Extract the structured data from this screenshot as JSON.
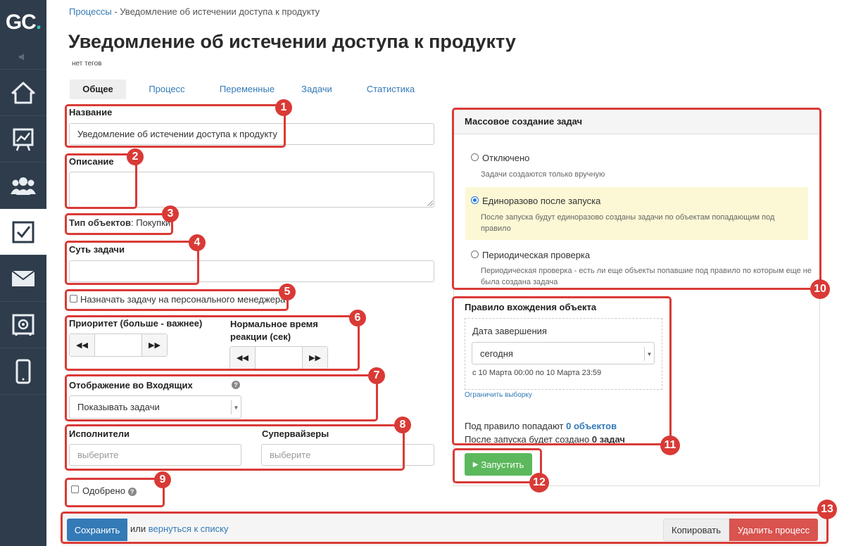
{
  "sidebar": {
    "logo": "GC",
    "logo_dot": ".",
    "items": [
      {
        "name": "home"
      },
      {
        "name": "stats"
      },
      {
        "name": "users"
      },
      {
        "name": "tasks",
        "active": true
      },
      {
        "name": "mail"
      },
      {
        "name": "safe"
      },
      {
        "name": "mobile"
      }
    ]
  },
  "breadcrumb": {
    "link": "Процессы",
    "separator": "-",
    "current": "Уведомление об истечении доступа к продукту"
  },
  "page": {
    "title": "Уведомление об истечении доступа к продукту",
    "tags": "нет тегов"
  },
  "tabs": [
    "Общее",
    "Процесс",
    "Переменные",
    "Задачи",
    "Статистика"
  ],
  "form": {
    "name_label": "Название",
    "name_value": "Уведомление об истечении доступа к продукту",
    "description_label": "Описание",
    "object_type_label": "Тип объектов",
    "object_type_value": ": Покупки",
    "task_essence_label": "Суть задачи",
    "assign_manager_label": "Назначать задачу на персонального менеджера",
    "priority_label": "Приоритет (больше - важнее)",
    "reaction_label": "Нормальное время реакции (сек)",
    "inbox_label": "Отображение во Входящих",
    "inbox_value": "Показывать задачи",
    "executors_label": "Исполнители",
    "executors_placeholder": "выберите",
    "supervisors_label": "Супервайзеры",
    "supervisors_placeholder": "выберите",
    "approved_label": "Одобрено"
  },
  "mass_creation": {
    "title": "Массовое создание задач",
    "options": [
      {
        "label": "Отключено",
        "desc": "Задачи создаются только вручную",
        "selected": false
      },
      {
        "label": "Единоразово после запуска",
        "desc": "После запуска будут единоразово созданы задачи по объектам попадающим под правило",
        "selected": true
      },
      {
        "label": "Периодическая проверка",
        "desc": "Периодическая проверка - есть ли еще объекты попавшие под правило по которым еще не была создана задача",
        "selected": false
      }
    ]
  },
  "rule": {
    "title": "Правило вхождения объекта",
    "date_label": "Дата завершения",
    "date_value": "сегодня",
    "date_range": "с 10 Марта 00:00 по 10 Марта 23:59",
    "limit_link": "Ограничить выборку",
    "match_prefix": "Под правило попадают",
    "match_value": "0 объектов",
    "created_prefix": "После запуска будет создано",
    "created_value": "0 задач",
    "run_button": "Запустить"
  },
  "footer": {
    "save": "Сохранить",
    "or": "или",
    "back_link": "вернуться к списку",
    "copy": "Копировать",
    "delete": "Удалить процесс"
  },
  "annotations": [
    "1",
    "2",
    "3",
    "4",
    "5",
    "6",
    "7",
    "8",
    "9",
    "10",
    "11",
    "12",
    "13"
  ],
  "colors": {
    "sidebar": "#2e3c4b",
    "link": "#337ab7",
    "annotation": "#d93a36",
    "run": "#5cb85c",
    "delete": "#d9534f",
    "save": "#337ab7"
  }
}
